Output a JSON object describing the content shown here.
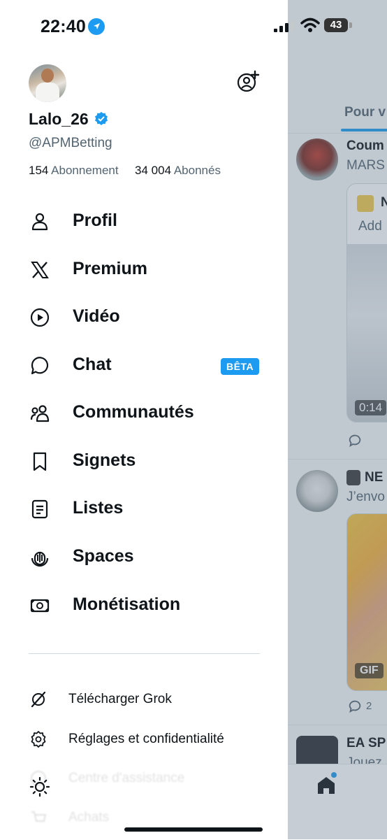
{
  "status_bar": {
    "time": "22:40",
    "battery": "43"
  },
  "profile": {
    "display_name": "Lalo_26",
    "handle": "@APMBetting",
    "following_count": "154",
    "following_label": "Abonnement",
    "followers_count": "34 004",
    "followers_label": "Abonnés"
  },
  "menu": {
    "items": [
      {
        "label": "Profil",
        "icon": "person-icon"
      },
      {
        "label": "Premium",
        "icon": "x-logo-icon"
      },
      {
        "label": "Vidéo",
        "icon": "play-circle-icon"
      },
      {
        "label": "Chat",
        "icon": "chat-bubble-icon",
        "badge": "BÊTA"
      },
      {
        "label": "Communautés",
        "icon": "people-icon"
      },
      {
        "label": "Signets",
        "icon": "bookmark-icon"
      },
      {
        "label": "Listes",
        "icon": "list-icon"
      },
      {
        "label": "Spaces",
        "icon": "spaces-icon"
      },
      {
        "label": "Monétisation",
        "icon": "money-icon"
      }
    ],
    "secondary": [
      {
        "label": "Télécharger Grok",
        "icon": "grok-icon"
      },
      {
        "label": "Réglages et confidentialité",
        "icon": "gear-icon"
      },
      {
        "label": "Centre d'assistance",
        "icon": "help-icon"
      },
      {
        "label": "Achats",
        "icon": "cart-icon"
      }
    ]
  },
  "feed": {
    "tab": "Pour v",
    "posts": [
      {
        "name": "Coum",
        "text": "MARS",
        "card_title": "N",
        "card_sub": "Add",
        "video_time": "0:14"
      },
      {
        "name": "NE",
        "text": "J’envo",
        "badge": "GIF",
        "reply_count": "2"
      },
      {
        "name": "EA SP",
        "text": "Jouez"
      }
    ]
  },
  "colors": {
    "accent": "#1d9bf0",
    "text": "#0f1419",
    "secondary_text": "#536471"
  }
}
